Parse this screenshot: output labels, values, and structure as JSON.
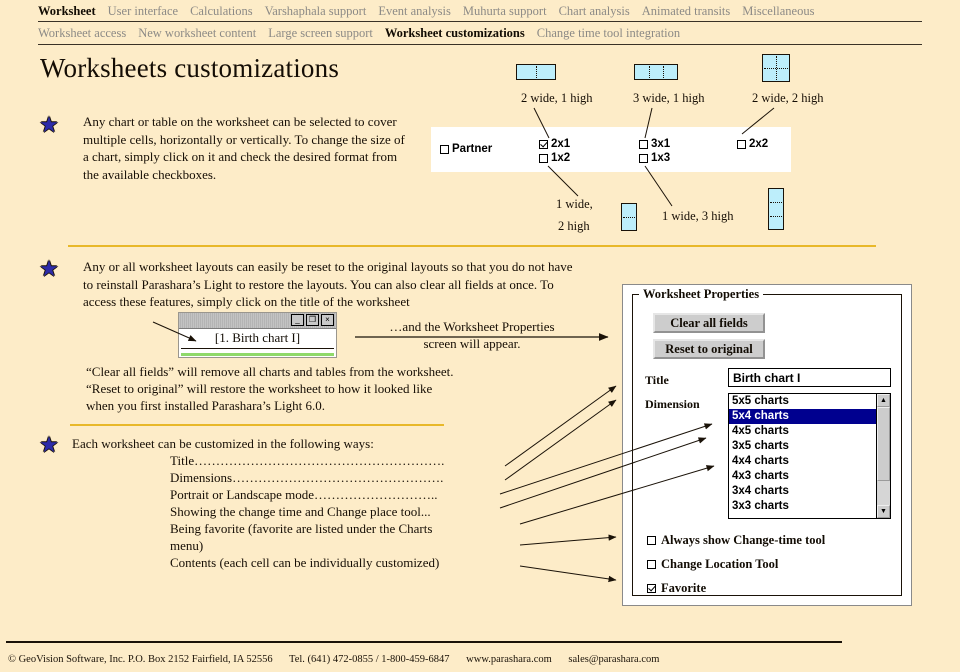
{
  "nav": {
    "primary": [
      {
        "label": "Worksheet",
        "active": true
      },
      {
        "label": "User interface",
        "active": false
      },
      {
        "label": "Calculations",
        "active": false
      },
      {
        "label": "Varshaphala support",
        "active": false
      },
      {
        "label": "Event analysis",
        "active": false
      },
      {
        "label": "Muhurta support",
        "active": false
      },
      {
        "label": "Chart analysis",
        "active": false
      },
      {
        "label": "Animated transits",
        "active": false
      },
      {
        "label": "Miscellaneous",
        "active": false
      }
    ],
    "secondary": [
      {
        "label": "Worksheet access",
        "active": false
      },
      {
        "label": "New worksheet content",
        "active": false
      },
      {
        "label": "Large screen support",
        "active": false
      },
      {
        "label": "Worksheet customizations",
        "active": true
      },
      {
        "label": "Change time tool integration",
        "active": false
      }
    ]
  },
  "page_title": "Worksheets customizations",
  "bullets": {
    "b1": "Any chart or table on the worksheet can be selected to cover multiple cells, horizontally or vertically. To change the size of a chart, simply click on it and check the desired format from the available checkboxes.",
    "b2": "Any or all worksheet layouts can easily be reset to the original layouts so that you do not have to reinstall Parashara’s Light to restore the layouts. You can also clear all fields at once. To access these features, simply click on the title of the worksheet",
    "b2_note1": "“Clear all fields” will remove all charts and tables from the worksheet.",
    "b2_note2": "“Reset to original” will restore the worksheet to how it looked like",
    "b2_note3": "when you first installed Parashara’s Light 6.0.",
    "b3": "Each worksheet can be customized in the following ways:"
  },
  "customization_list": [
    "Title………………………………………………….",
    "Dimensions………………………………………….",
    "Portrait or Landscape mode………………………..",
    "Showing the change time and Change place tool...",
    "Being favorite (favorite are listed under the Charts",
    "menu)",
    "Contents (each cell can be individually customized)"
  ],
  "cell_diagrams": {
    "top": [
      {
        "label": "2 wide, 1 high",
        "cols": 2,
        "rows": 1
      },
      {
        "label": "3 wide, 1 high",
        "cols": 3,
        "rows": 1
      },
      {
        "label": "2 wide, 2 high",
        "cols": 2,
        "rows": 2
      }
    ],
    "bottom": [
      {
        "label_line1": "1 wide,",
        "label_line2": "2 high",
        "cols": 1,
        "rows": 2
      },
      {
        "label_line1": "1 wide, 3 high",
        "label_line2": "",
        "cols": 1,
        "rows": 3
      }
    ]
  },
  "checkbox_strip": {
    "partner": {
      "label": "Partner",
      "checked": false
    },
    "options": [
      {
        "label": "2x1",
        "checked": true
      },
      {
        "label": "1x2",
        "checked": false
      },
      {
        "label": "3x1",
        "checked": false
      },
      {
        "label": "1x3",
        "checked": false
      },
      {
        "label": "2x2",
        "checked": false
      }
    ]
  },
  "mini_window": {
    "title": "[1. Birth chart I]",
    "buttons": [
      "_",
      "❐",
      "×"
    ]
  },
  "callout": {
    "line1": "…and the Worksheet Properties",
    "line2": "screen will appear."
  },
  "worksheet_properties": {
    "legend": "Worksheet Properties",
    "clear_button": "Clear all fields",
    "reset_button": "Reset to original",
    "title_label": "Title",
    "title_value": "Birth chart I",
    "dimension_label": "Dimension",
    "dimension_options": [
      {
        "label": "5x5 charts",
        "selected": false
      },
      {
        "label": "5x4 charts",
        "selected": true
      },
      {
        "label": "4x5 charts",
        "selected": false
      },
      {
        "label": "3x5 charts",
        "selected": false
      },
      {
        "label": "4x4 charts",
        "selected": false
      },
      {
        "label": "4x3 charts",
        "selected": false
      },
      {
        "label": "3x4 charts",
        "selected": false
      },
      {
        "label": "3x3 charts",
        "selected": false
      }
    ],
    "scroll_up": "▲",
    "scroll_down": "▼",
    "checkboxes": [
      {
        "label": "Always show Change-time tool",
        "checked": false
      },
      {
        "label": "Change Location Tool",
        "checked": false
      },
      {
        "label": "Favorite",
        "checked": true
      }
    ]
  },
  "footer": {
    "company": "© GeoVision Software, Inc. P.O. Box 2152 Fairfield, IA 52556",
    "phone": "Tel. (641) 472-0855 / 1-800-459-6847",
    "website": "www.parashara.com",
    "email": "sales@parashara.com"
  },
  "colors": {
    "background": "#fdecc8",
    "divider": "#e8b82a",
    "star": "#2d2ba8",
    "cell_fill": "#bdeefb",
    "selection": "#00008f"
  },
  "icons": {
    "star": "★"
  }
}
